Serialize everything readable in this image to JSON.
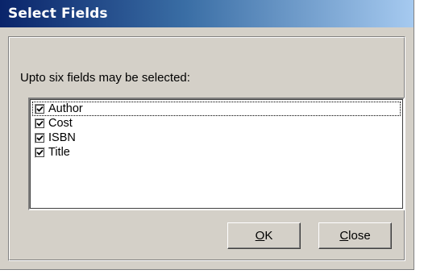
{
  "window": {
    "title": "Select Fields"
  },
  "prompt": "Upto six fields may be selected:",
  "fields": [
    {
      "label": "Author",
      "checked": true,
      "focused": true
    },
    {
      "label": "Cost",
      "checked": true,
      "focused": false
    },
    {
      "label": "ISBN",
      "checked": true,
      "focused": false
    },
    {
      "label": "Title",
      "checked": true,
      "focused": false
    }
  ],
  "buttons": {
    "ok": {
      "mnemonic": "O",
      "rest": "K"
    },
    "close": {
      "mnemonic": "C",
      "rest": "lose"
    }
  },
  "colors": {
    "face": "#d4d0c8",
    "title_start": "#0a246a",
    "title_end": "#a6caf0"
  }
}
